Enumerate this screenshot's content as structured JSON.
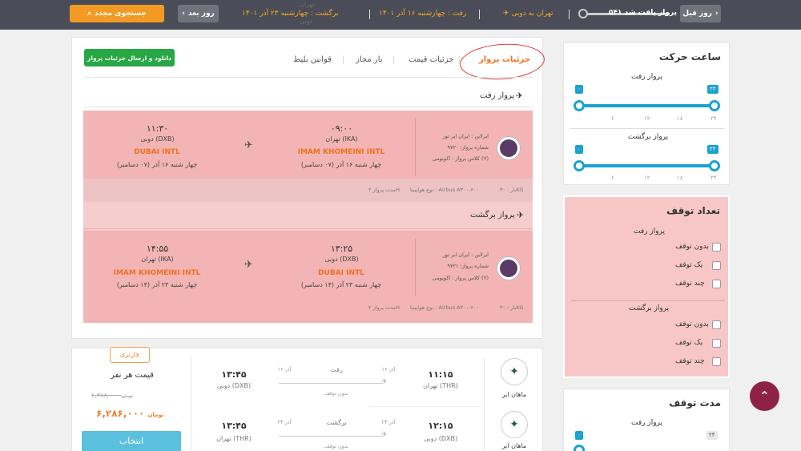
{
  "topbar": {
    "prev_day": "روز قبل",
    "results_found": "۵۴۱ پرواز یافت شد",
    "route": "تهران به دوبی",
    "depart": "رفت : چهارشنبه ۱۶ آذر ۱۴۰۱",
    "return": "برگشت : چهارشنبه ۲۳ آذر ۱۴۰۱",
    "next_day": "روز بعد",
    "new_search": "جستجوی مجدد"
  },
  "filters": {
    "departure_time": {
      "title": "ساعت حرکت",
      "outbound_label": "پرواز رفت",
      "return_label": "پرواز برگشت",
      "min_tag": "۰",
      "max_tag": "۲۴",
      "ticks": [
        "۲۴",
        "۱۸",
        "۱۲",
        "۶",
        "۰"
      ]
    },
    "stops": {
      "title": "تعداد توقف",
      "outbound_label": "پرواز رفت",
      "return_label": "پرواز برگشت",
      "options": [
        "بدون توقف",
        "یک توقف",
        "چند توقف"
      ]
    },
    "stop_duration": {
      "title": "مدت توقف",
      "outbound_label": "پرواز رفت",
      "min_tag": "۰",
      "max_tag": "۲۴"
    }
  },
  "details": {
    "tabs": [
      "جزئیات پرواز",
      "جزئیات قیمت",
      "بار مجاز",
      "قوانین بلیط"
    ],
    "download_button": "دانلود و ارسال جزئیات پرواز",
    "outbound_title": "پرواز رفت",
    "return_title": "پرواز برگشت",
    "outbound": {
      "airline": "ایرلاین : ایران ایر تور",
      "flight_no": "شماره پرواز: ۹۷۲۰",
      "class": "کلاس پرواز : اکونومی (Y)",
      "dep_time": "۰۹:۰۰",
      "dep_city": "تهران (IKA)",
      "dep_airport": "IMAM KHOMEINI INTL",
      "dep_date": "چهار شنبه ۱۶ آذر (۰۷ دسامبر)",
      "arr_time": "۱۱:۳۰",
      "arr_city": "دوبی (DXB)",
      "arr_airport": "DUBAI INTL",
      "arr_date": "چهار شنبه ۱۶ آذر (۰۷ دسامبر)",
      "baggage": "بار : ۳۰KG",
      "aircraft": "نوع هواپیما : Airbus A۳۰۰-۶۰۰",
      "duration": "مدت پرواز ۲H"
    },
    "return": {
      "airline": "ایرلاین : ایران ایر تور",
      "flight_no": "شماره پرواز: ۹۷۲۱",
      "class": "کلاس پرواز : اکونومی (Y)",
      "dep_time": "۱۳:۲۵",
      "dep_city": "دوبی (DXB)",
      "dep_airport": "DUBAI INTL",
      "dep_date": "چهار شنبه ۲۳ آذر (۱۴ دسامبر)",
      "arr_time": "۱۴:۵۵",
      "arr_city": "تهران (IKA)",
      "arr_airport": "IMAM KHOMEINI INTL",
      "arr_date": "چهار شنبه ۲۳ آذر (۱۴ دسامبر)",
      "baggage": "بار : ۳۰KG",
      "aircraft": "نوع هواپیما : Airbus A۳۰۰-۶۰۰",
      "duration": "مدت پرواز ۲H"
    }
  },
  "result": {
    "airline": "ماهان ایر",
    "out_dep_time": "۱۱:۱۵",
    "out_dep_city": "تهران (THR)",
    "out_dep_date": "۱۶ آذر",
    "out_dir": "رفت",
    "out_stop": "بدون توقف",
    "out_arr_date": "۱۶ آذر",
    "out_arr_time": "۱۳:۴۵",
    "out_arr_city": "دوبی (DXB)",
    "ret_dep_time": "۱۲:۱۵",
    "ret_dep_city": "دوبی (DXB)",
    "ret_dep_date": "۲۳ آذر",
    "ret_dir": "برگشت",
    "ret_stop": "بدون توقف",
    "ret_arr_date": "۲۳ آذر",
    "ret_arr_time": "۱۳:۴۵",
    "ret_arr_city": "تهران (THR)",
    "badge": "چارتری",
    "price_label": "قیمت هر نفر",
    "old_price": "۶,۳۸۸,۰۰۰",
    "old_unit": "تومان",
    "price": "۶,۲۸۶,۰۰۰",
    "unit": "تومان",
    "select_button": "انتخاب"
  },
  "colors": {
    "accent": "#f0711f",
    "slider": "#1aa3cf",
    "highlight": "#f7c7c7",
    "scroll_top": "#8e2246"
  }
}
